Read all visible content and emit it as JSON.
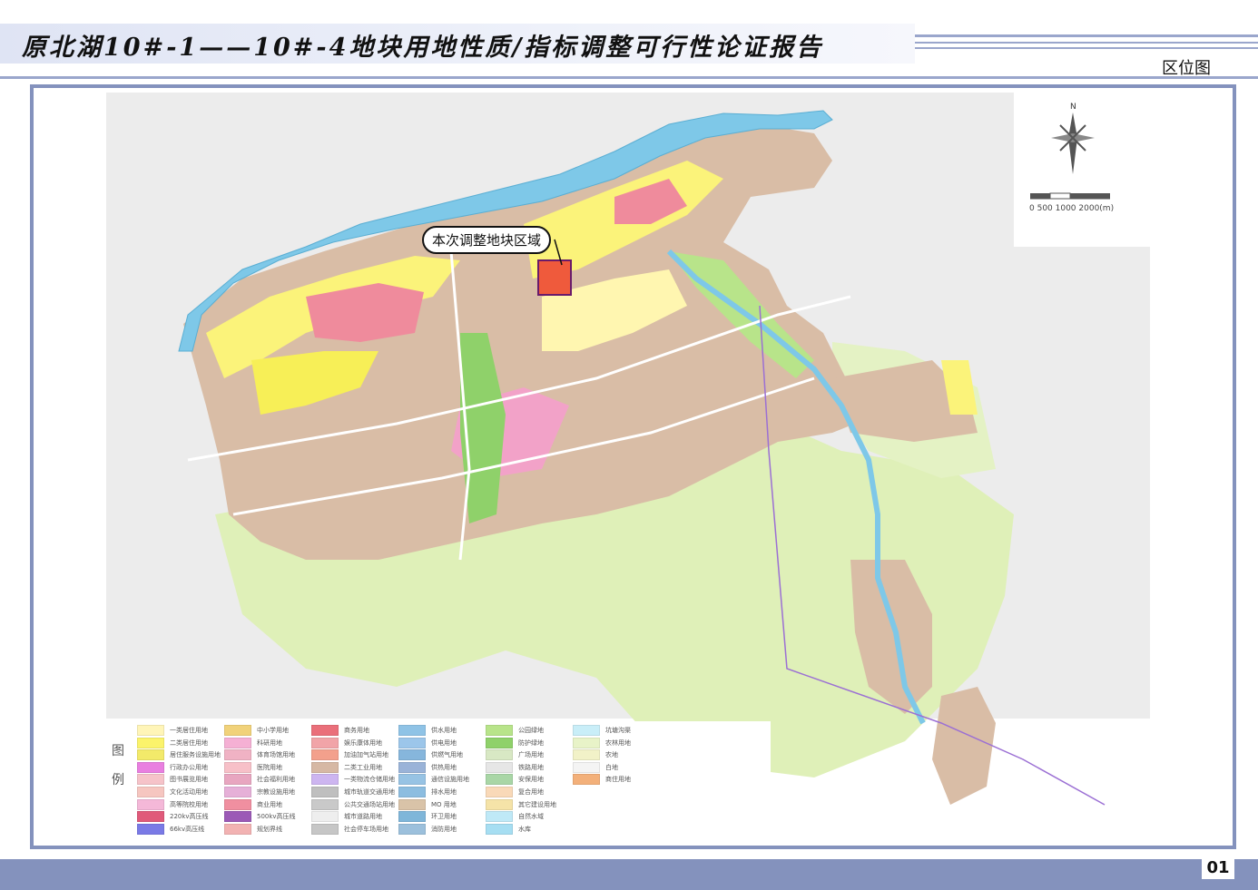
{
  "header": {
    "title": "原北湖10#-1——10#-4地块用地性质/指标调整可行性论证报告",
    "section": "区位图"
  },
  "map": {
    "callout": "本次调整地块区域",
    "north": "N",
    "scale_text": "0   500  1000        2000(m)",
    "colors": {
      "river": "#7ec8e8",
      "residential_1": "#fff2a8",
      "residential_2": "#f7ef57",
      "commercial": "#f08fa0",
      "industrial": "#d6b8a4",
      "green": "#cfe8a0",
      "park": "#8fd16a",
      "education": "#f4b8d8",
      "target": "#ef5a3c"
    }
  },
  "legend": {
    "title_a": "图",
    "title_b": "例",
    "items": [
      {
        "label": "一类居住用地",
        "color": "#fff5b8"
      },
      {
        "label": "二类居住用地",
        "color": "#fbf36b"
      },
      {
        "label": "居住服务设施用地",
        "color": "#f3ea6a"
      },
      {
        "label": "行政办公用地",
        "color": "#e97fe0"
      },
      {
        "label": "图书展览用地",
        "color": "#f6c3c9"
      },
      {
        "label": "文化活动用地",
        "color": "#f6c6c0"
      },
      {
        "label": "高等院校用地",
        "color": "#f4b8d8"
      },
      {
        "label": "220kv高压线",
        "color": "#e05a7a"
      },
      {
        "label": "66kv高压线",
        "color": "#7a7ae6"
      },
      {
        "label": "中小学用地",
        "color": "#f1d27a"
      },
      {
        "label": "科研用地",
        "color": "#f5b0d4"
      },
      {
        "label": "体育场馆用地",
        "color": "#f0b2c4"
      },
      {
        "label": "医院用地",
        "color": "#f7c0c8"
      },
      {
        "label": "社会福利用地",
        "color": "#e8a6c0"
      },
      {
        "label": "宗教设施用地",
        "color": "#e6b0d8"
      },
      {
        "label": "商业用地",
        "color": "#f08fa0"
      },
      {
        "label": "500kv高压线",
        "color": "#9b59b6"
      },
      {
        "label": "规划界线",
        "color": "#f2b2b2"
      },
      {
        "label": "商务用地",
        "color": "#ea6f7a"
      },
      {
        "label": "娱乐康体用地",
        "color": "#f1a4a8"
      },
      {
        "label": "加油加气站用地",
        "color": "#f3a08c"
      },
      {
        "label": "二类工业用地",
        "color": "#d6b8a4"
      },
      {
        "label": "一类物流仓储用地",
        "color": "#cdb5f0"
      },
      {
        "label": "城市轨道交通用地",
        "color": "#bfbfbf"
      },
      {
        "label": "公共交通场站用地",
        "color": "#c9c9c9"
      },
      {
        "label": "城市道路用地",
        "color": "#eeeeee"
      },
      {
        "label": "社会停车场用地",
        "color": "#c6c6c6"
      },
      {
        "label": "供水用地",
        "color": "#8fc3e6"
      },
      {
        "label": "供电用地",
        "color": "#9cc6ea"
      },
      {
        "label": "供燃气用地",
        "color": "#86b6dc"
      },
      {
        "label": "供热用地",
        "color": "#9ab3d8"
      },
      {
        "label": "通信设施用地",
        "color": "#97c3e4"
      },
      {
        "label": "排水用地",
        "color": "#8cbde0"
      },
      {
        "label": "MO 用地",
        "color": "#d9c3a8"
      },
      {
        "label": "环卫用地",
        "color": "#7fb6d9"
      },
      {
        "label": "消防用地",
        "color": "#9cc0dc"
      },
      {
        "label": "公园绿地",
        "color": "#b8e48a"
      },
      {
        "label": "防护绿地",
        "color": "#8fd16a"
      },
      {
        "label": "广场用地",
        "color": "#d8e8c4"
      },
      {
        "label": "铁路用地",
        "color": "#e6e6e6"
      },
      {
        "label": "安保用地",
        "color": "#a9d6a6"
      },
      {
        "label": "复合用地",
        "color": "#f9d9b8"
      },
      {
        "label": "其它建设用地",
        "color": "#f5e3a8"
      },
      {
        "label": "自然水域",
        "color": "#bfe9f7"
      },
      {
        "label": "水库",
        "color": "#a6def2"
      },
      {
        "label": "坑塘沟渠",
        "color": "#c9eef8"
      },
      {
        "label": "农林用地",
        "color": "#e8f3c8"
      },
      {
        "label": "农地",
        "color": "#f2f2c8"
      },
      {
        "label": "白地",
        "color": "#f4f4f4"
      },
      {
        "label": "商住用地",
        "color": "#f3b07a"
      }
    ]
  },
  "footer": {
    "page_number": "01"
  }
}
